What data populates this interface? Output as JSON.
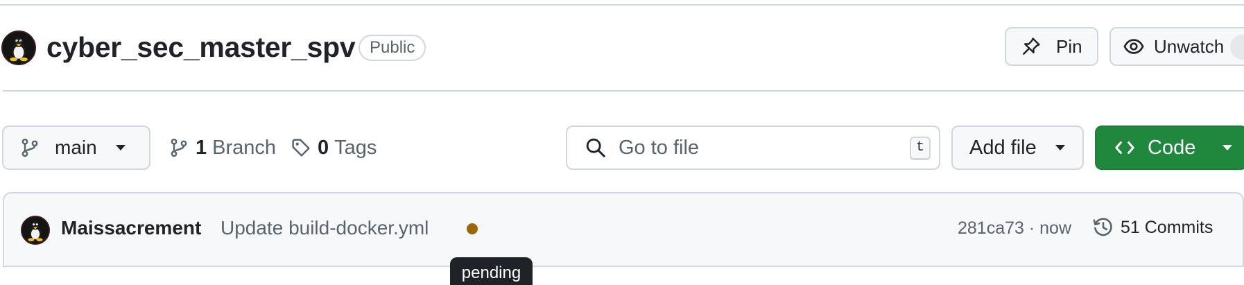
{
  "repo": {
    "name": "cyber_sec_master_spv",
    "visibility": "Public",
    "avatar_icon": "tux-penguin-icon"
  },
  "header_actions": {
    "pin_label": "Pin",
    "pin_icon": "pin-icon",
    "unwatch_label": "Unwatch",
    "unwatch_icon": "eye-icon"
  },
  "branch_bar": {
    "current_branch": "main",
    "branch_count": "1",
    "branch_label": "Branch",
    "tag_count": "0",
    "tag_label": "Tags",
    "search_placeholder": "Go to file",
    "search_shortcut": "t",
    "add_file_label": "Add file",
    "code_label": "Code"
  },
  "latest_commit": {
    "author": "Maissacrement",
    "message": "Update build-docker.yml",
    "sha_time": "281ca73 · now",
    "commits_label": "51 Commits",
    "status_color": "#9a6700",
    "status_tooltip": "pending"
  },
  "colors": {
    "primary_green": "#1f883d",
    "border": "#d0d7de",
    "muted_text": "#59636e"
  }
}
